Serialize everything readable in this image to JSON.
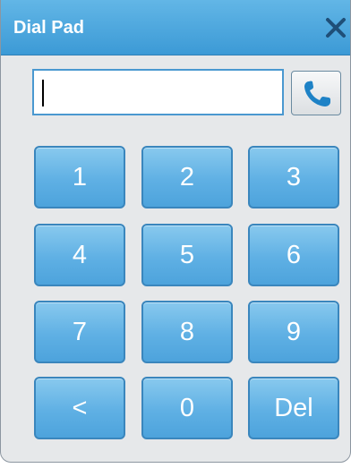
{
  "window": {
    "title": "Dial Pad"
  },
  "number_input": {
    "value": "",
    "placeholder": ""
  },
  "icons": {
    "close": "close-icon",
    "call": "phone-icon"
  },
  "keys": [
    "1",
    "2",
    "3",
    "4",
    "5",
    "6",
    "7",
    "8",
    "9",
    "<",
    "0",
    "Del"
  ],
  "colors": {
    "titlebar": "#4aa6dc",
    "key_fill": "#5fb0e4",
    "key_border": "#3a86bd",
    "input_border": "#4a98d0",
    "phone_icon": "#1e82c6"
  }
}
